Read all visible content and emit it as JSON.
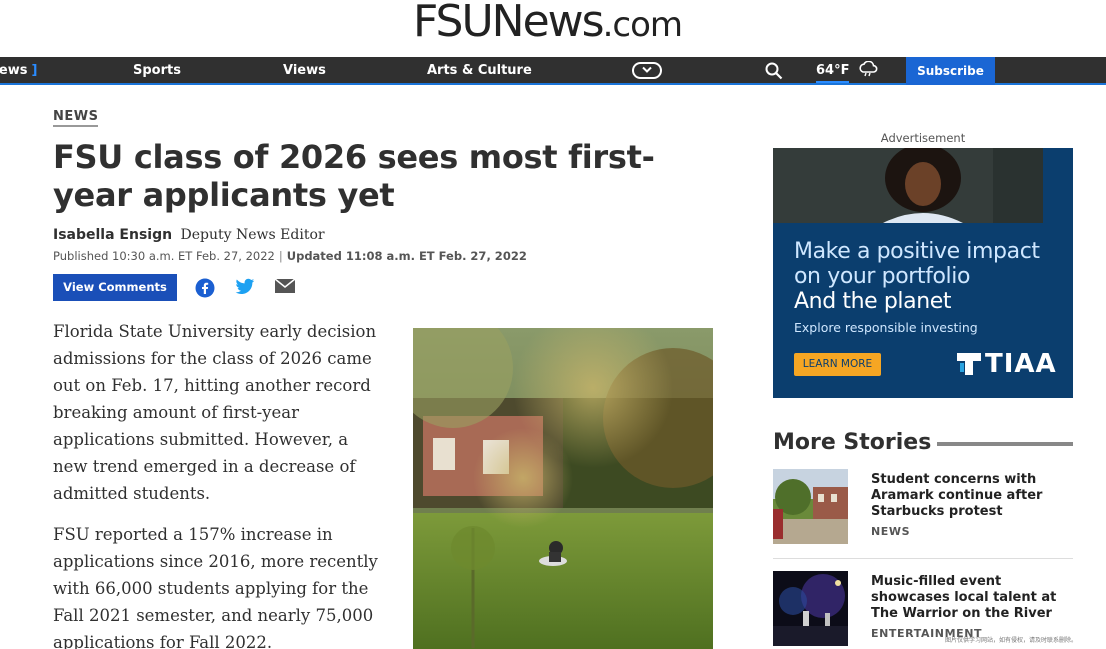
{
  "logo": {
    "brand": "FSUNews",
    "suffix": ".com"
  },
  "nav": {
    "items": [
      {
        "label": "News"
      },
      {
        "label": "Sports"
      },
      {
        "label": "Views"
      },
      {
        "label": "Arts & Culture"
      }
    ],
    "weather_temp": "64°F",
    "subscribe_label": "Subscribe",
    "accent_color": "#1a66d4"
  },
  "article": {
    "section": "NEWS",
    "headline": "FSU class of 2026 sees most first-year applicants yet",
    "author": "Isabella Ensign",
    "author_role": "Deputy News Editor",
    "published": "Published 10:30 a.m. ET Feb. 27, 2022",
    "updated": "Updated 11:08 a.m. ET Feb. 27, 2022",
    "view_comments_label": "View Comments",
    "share_icons": [
      "facebook-icon",
      "twitter-icon",
      "email-icon"
    ],
    "paragraphs": [
      "Florida State University early decision admissions for the class of 2026 came out on Feb. 17, hitting another record breaking amount of first-year applications submitted. However, a new trend emerged in a decrease of admitted students.",
      "FSU reported a 157% increase in applications since 2016, more recently with 66,000 students applying for the Fall 2021 semester, and nearly 75,000 applications for Fall 2022."
    ]
  },
  "sidebar": {
    "ad_label": "Advertisement",
    "ad": {
      "line1": "Make a positive impact",
      "line2": "on your portfolio",
      "line3": "And the planet",
      "sub": "Explore responsible investing",
      "button": "LEARN MORE",
      "brand": "TIAA"
    },
    "more_stories_title": "More Stories",
    "stories": [
      {
        "headline": "Student concerns with Aramark continue after Starbucks protest",
        "section": "NEWS"
      },
      {
        "headline": "Music-filled event showcases local talent at The Warrior on the River",
        "section": "ENTERTAINMENT"
      }
    ]
  },
  "watermark": "图片仅供学习网站，如有侵权，请及时联系删除。"
}
